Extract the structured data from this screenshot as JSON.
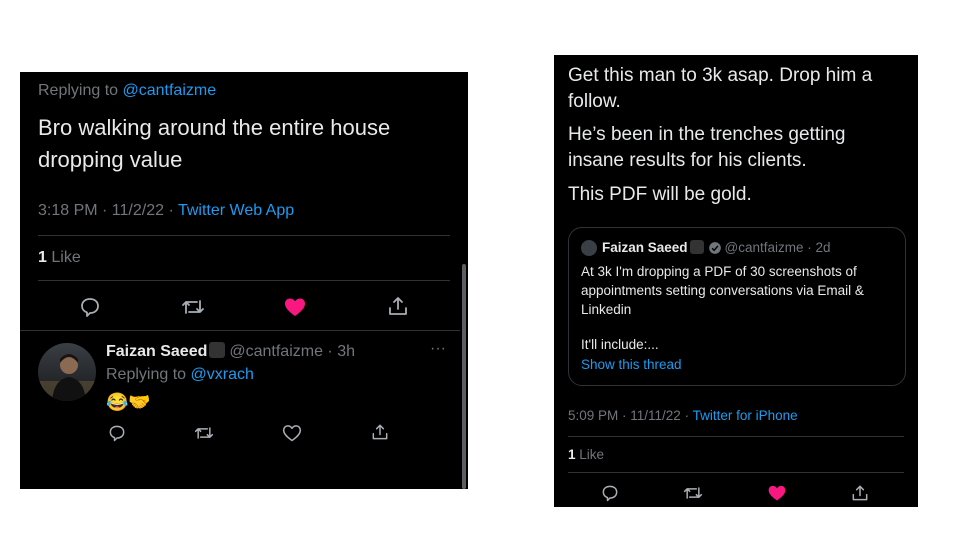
{
  "left": {
    "replying_prefix": "Replying to",
    "replying_handle": "@cantfaizme",
    "tweet_text_line1": "Bro walking around the entire house",
    "tweet_text_line2": "dropping value",
    "meta_time": "3:18 PM · 11/2/22 · ",
    "meta_source": "Twitter Web App",
    "likes_count": "1",
    "likes_label": "Like",
    "reply": {
      "name": "Faizan Saeed",
      "handle_time": "@cantfaizme · 3h",
      "more": "···",
      "replying_prefix": "Replying to",
      "replying_handle": "@vxrach",
      "emojis": "😂🤝"
    }
  },
  "right": {
    "text1_line1": "Get this man to 3k asap. Drop him a",
    "text1_line2": "follow.",
    "text2_line1": "He’s been in the trenches getting",
    "text2_line2": "insane results for his clients.",
    "text3": "This PDF will be gold.",
    "quote": {
      "name": "Faizan Saeed",
      "handle_time": "@cantfaizme · 2d",
      "line1": "At 3k I'm dropping a PDF of 30 screenshots of",
      "line2": "appointments setting conversations via Email &",
      "line3": "Linkedin",
      "line4": "It'll include:...",
      "show_thread": "Show this thread"
    },
    "meta_time": "5:09 PM · 11/11/22 · ",
    "meta_source": "Twitter for iPhone",
    "likes_count": "1",
    "likes_label": "Like"
  },
  "colors": {
    "background": "#000000",
    "text": "#e7e9ea",
    "muted": "#71767b",
    "link": "#1d9bf0",
    "like": "#f91880"
  }
}
